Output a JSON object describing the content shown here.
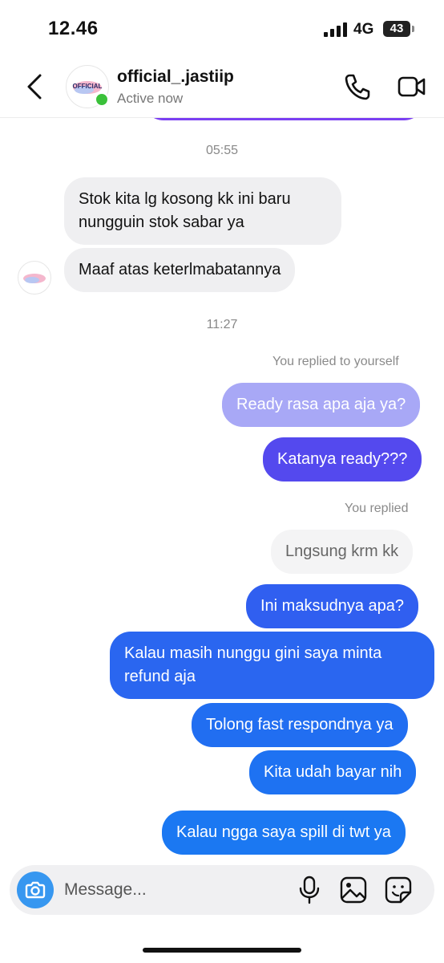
{
  "status_bar": {
    "time": "12.46",
    "network": "4G",
    "battery": "43"
  },
  "header": {
    "contact_name": "official_.jastiip",
    "status": "Active now",
    "avatar_text": "OFFICIAL"
  },
  "timestamps": [
    "05:55",
    "11:27"
  ],
  "notes": {
    "replied_to_yourself": "You replied to yourself",
    "you_replied": "You replied"
  },
  "messages": [
    {
      "side": "incoming",
      "text": "Stok kita lg kosong kk ini baru nungguin stok sabar ya"
    },
    {
      "side": "incoming",
      "text": "Maaf atas keterlmabatannya"
    },
    {
      "side": "quoted-outgoing",
      "text": "Ready rasa apa aja ya?"
    },
    {
      "side": "outgoing",
      "text": "Katanya ready???"
    },
    {
      "side": "quoted",
      "text": "Lngsung krm kk"
    },
    {
      "side": "outgoing",
      "text": "Ini maksudnya apa?"
    },
    {
      "side": "outgoing",
      "text": "Kalau masih nunggu gini saya minta refund aja"
    },
    {
      "side": "outgoing",
      "text": "Tolong fast respondnya ya"
    },
    {
      "side": "outgoing",
      "text": "Kita udah bayar nih"
    },
    {
      "side": "outgoing",
      "text": "Kalau ngga saya spill di twt ya"
    }
  ],
  "composer": {
    "placeholder": "Message..."
  },
  "colors": {
    "accent": "#3797f0",
    "online": "#3ac13a",
    "outgoing_gradient": [
      "#5b4cf0",
      "#2f6ff0",
      "#1b78f2"
    ],
    "incoming_bg": "#efeff1"
  },
  "icons": {
    "back": "chevron-left-icon",
    "call": "phone-icon",
    "video": "video-camera-icon",
    "camera": "camera-icon",
    "mic": "microphone-icon",
    "gallery": "image-icon",
    "sticker": "sticker-icon"
  }
}
